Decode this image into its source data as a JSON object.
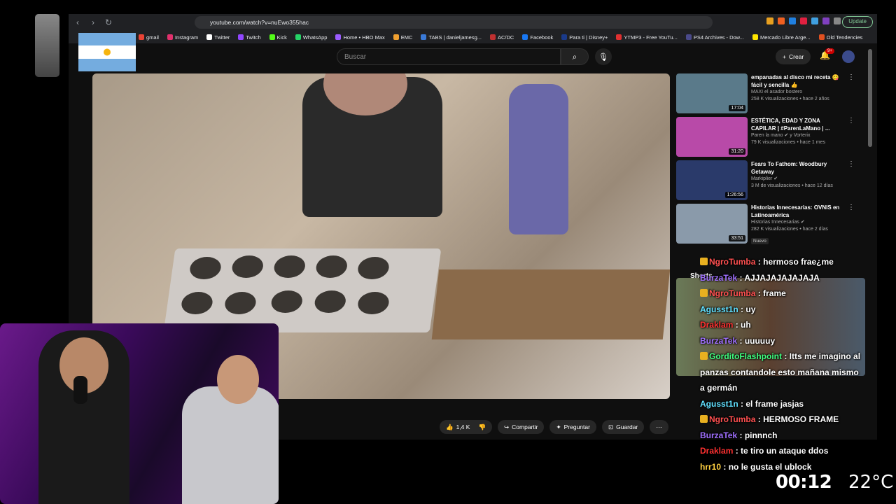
{
  "browser": {
    "url": "youtube.com/watch?v=nuEwo355hac",
    "update_label": "Update",
    "bookmarks": [
      "gmail",
      "Instagram",
      "Twitter",
      "Twitch",
      "Kick",
      "WhatsApp",
      "Home • HBO Max",
      "EMC",
      "TABS | danieljamesg...",
      "AC/DC",
      "Facebook",
      "Para ti | Disney+",
      "YTMP3 - Free YouTu...",
      "PS4 Archives - Dow...",
      "Mercado Libre Arge...",
      "Old Tendencies"
    ]
  },
  "youtube": {
    "search_placeholder": "Buscar",
    "create_label": "Crear",
    "notif_count": "9+",
    "like_count": "1,4 K",
    "share_label": "Compartir",
    "ask_label": "Preguntar",
    "save_label": "Guardar",
    "recommendations": [
      {
        "title": "empanadas al disco mi receta 😋 fácil y sencilla 👍",
        "channel": "MAXI el asador bostero",
        "meta": "258 K visualizaciones • hace 2 años",
        "duration": "17:04",
        "color": "#5a7a8a"
      },
      {
        "title": "ESTÉTICA, EDAD Y ZONA CAPILAR | #ParenLaMano | ...",
        "channel": "Paren la mano ✔ y Vorterix",
        "meta": "79 K visualizaciones • hace 1 mes",
        "duration": "31:20",
        "color": "#b84aa8"
      },
      {
        "title": "Fears To Fathom: Woodbury Getaway",
        "channel": "Markiplier ✔",
        "meta": "3 M de visualizaciones • hace 12 días",
        "duration": "1:26:56",
        "color": "#2a3a6a"
      },
      {
        "title": "Historias Innecesarias: OVNIS en Latinoamérica",
        "channel": "Historias Innecesarias ✔",
        "meta": "282 K visualizaciones • hace 2 días",
        "duration": "33:51",
        "color": "#8a9aaa",
        "badge": "Nuevo"
      }
    ],
    "shorts_label": "Shorts"
  },
  "chat": [
    {
      "user": "NgroTumba",
      "color": "#ff5050",
      "msg": "hermoso frae¿me",
      "icon": true
    },
    {
      "user": "BurzaTek",
      "color": "#a070ff",
      "msg": "AJJAJAJAJAJAJA",
      "icon": false
    },
    {
      "user": "NgroTumba",
      "color": "#ff5050",
      "msg": "frame",
      "icon": true
    },
    {
      "user": "Agusst1n",
      "color": "#60e0ff",
      "msg": "uy",
      "icon": false
    },
    {
      "user": "Draklam",
      "color": "#ff3030",
      "msg": "uh",
      "icon": false
    },
    {
      "user": "BurzaTek",
      "color": "#a070ff",
      "msg": "uuuuuy",
      "icon": false
    },
    {
      "user": "GorditoFlashpoint",
      "color": "#40ff80",
      "msg": "Itts me imagino al panzas contandole esto mañana mismo a germán",
      "icon": true
    },
    {
      "user": "Agusst1n",
      "color": "#60e0ff",
      "msg": "el frame jasjas",
      "icon": false
    },
    {
      "user": "NgroTumba",
      "color": "#ff5050",
      "msg": "HERMOSO FRAME",
      "icon": true
    },
    {
      "user": "BurzaTek",
      "color": "#a070ff",
      "msg": "pinnnch",
      "icon": false
    },
    {
      "user": "Draklam",
      "color": "#ff3030",
      "msg": "te tiro un ataque ddos",
      "icon": false
    },
    {
      "user": "hrr10",
      "color": "#ffd040",
      "msg": "no le gusta el ublock",
      "icon": false
    }
  ],
  "overlay": {
    "clock": "00:12",
    "temperature": "22°C"
  }
}
